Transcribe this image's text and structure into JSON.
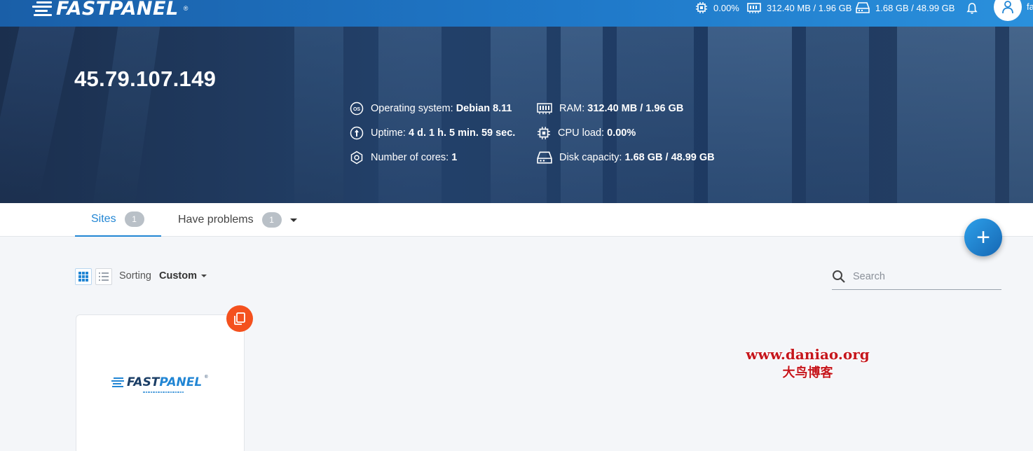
{
  "topbar": {
    "logo": "FASTPANEL",
    "logo_mark": "®",
    "cpu": "0.00%",
    "ram": "312.40 MB / 1.96 GB",
    "disk": "1.68 GB / 48.99 GB",
    "user_initial": "fa"
  },
  "server": {
    "ip": "45.79.107.149",
    "os_label": "Operating system:",
    "os_value": "Debian 8.11",
    "uptime_label": "Uptime:",
    "uptime_value": "4 d. 1 h. 5 min. 59 sec.",
    "cores_label": "Number of cores:",
    "cores_value": "1",
    "ram_label": "RAM:",
    "ram_value": "312.40 MB / 1.96 GB",
    "cpu_label": "CPU load:",
    "cpu_value": "0.00%",
    "disk_label": "Disk capacity:",
    "disk_value": "1.68 GB / 48.99 GB"
  },
  "tabs": [
    {
      "label": "Sites",
      "count": "1",
      "active": true
    },
    {
      "label": "Have problems",
      "count": "1",
      "active": false
    }
  ],
  "fab_label": "+",
  "toolbar": {
    "sorting_label": "Sorting",
    "sorting_value": "Custom",
    "search_placeholder": "Search"
  },
  "site_card": {
    "logo_text_a": "FAST",
    "logo_text_b": "PANEL",
    "logo_mark": "®"
  },
  "watermark": {
    "line1": "www.daniao.org",
    "line2": "大鸟博客"
  },
  "colors": {
    "accent": "#2286d4",
    "copy_badge": "#f4511e",
    "watermark": "#c5161c"
  }
}
